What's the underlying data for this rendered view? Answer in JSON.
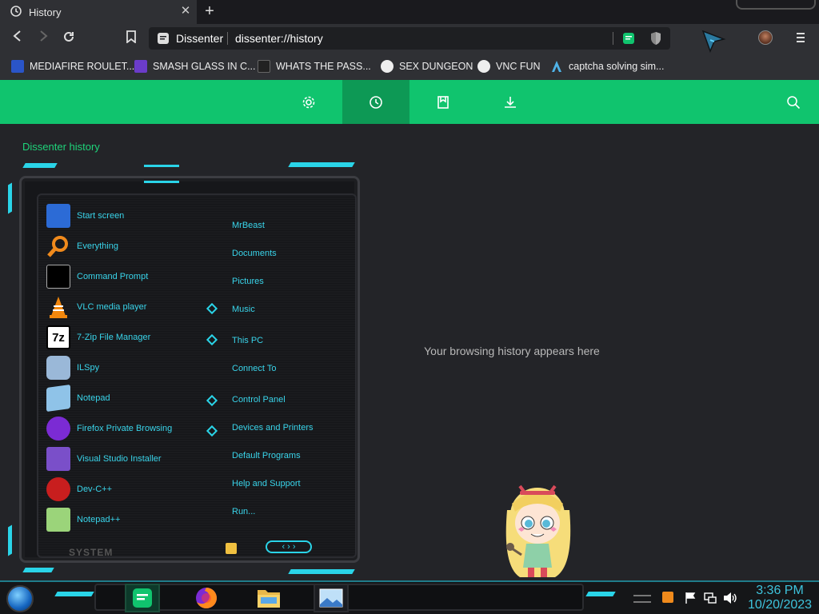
{
  "tab": {
    "title": "History",
    "close_icon": "close-icon",
    "new_tab_icon": "plus-icon"
  },
  "toolbar": {
    "site_name": "Dissenter",
    "url": "dissenter://history"
  },
  "bookmarks": [
    {
      "label": "MEDIAFIRE ROULET...",
      "icon": "mediafire-icon",
      "color": "#2a55c8"
    },
    {
      "label": "SMASH GLASS IN C...",
      "icon": "visualstudio-icon",
      "color": "#6b3cc9"
    },
    {
      "label": "WHATS THE PASS...",
      "icon": "site-icon",
      "color": "#222222"
    },
    {
      "label": "SEX DUNGEON",
      "icon": "github-icon",
      "color": "#eeeeee"
    },
    {
      "label": "VNC FUN",
      "icon": "github-icon",
      "color": "#eeeeee"
    },
    {
      "label": "captcha solving sim...",
      "icon": "arch-icon",
      "color": "#4fb3e8"
    }
  ],
  "appbar": {
    "accent": "#10c46e",
    "buttons": [
      "settings-icon",
      "history-icon",
      "bookmark-icon",
      "download-icon"
    ],
    "active": "history-icon",
    "search_icon": "search-icon"
  },
  "history": {
    "title": "Dissenter history",
    "empty_message": "Your browsing history appears here"
  },
  "start_menu": {
    "programs": [
      {
        "label": "Start screen",
        "icon": "start-screen-icon",
        "color": "#2c6bd6"
      },
      {
        "label": "Everything",
        "icon": "magnifier-icon",
        "color": "#f08a1c"
      },
      {
        "label": "Command Prompt",
        "icon": "cmd-icon",
        "color": "#111111"
      },
      {
        "label": "VLC media player",
        "icon": "vlc-icon",
        "color": "#f2870d"
      },
      {
        "label": "7-Zip File Manager",
        "icon": "7zip-icon",
        "color": "#ffffff"
      },
      {
        "label": "ILSpy",
        "icon": "ilspy-icon",
        "color": "#9ab8d8"
      },
      {
        "label": "Notepad",
        "icon": "notepad-icon",
        "color": "#8fc3e8"
      },
      {
        "label": "Firefox Private Browsing",
        "icon": "firefox-private-icon",
        "color": "#7b2bd4"
      },
      {
        "label": "Visual Studio Installer",
        "icon": "vs-installer-icon",
        "color": "#7a4fc9"
      },
      {
        "label": "Dev-C++",
        "icon": "devcpp-icon",
        "color": "#c81e1e"
      },
      {
        "label": "Notepad++",
        "icon": "notepadpp-icon",
        "color": "#9bd47a"
      }
    ],
    "places": [
      "MrBeast",
      "Documents",
      "Pictures",
      "Music",
      "This PC",
      "Connect To",
      "Control Panel",
      "Devices and Printers",
      "Default Programs",
      "Help and Support",
      "Run..."
    ],
    "system_label": "SYSTEM"
  },
  "taskbar": {
    "apps": [
      "notes-app-icon",
      "firefox-icon",
      "file-explorer-icon",
      "image-viewer-icon"
    ],
    "time": "3:36 PM",
    "date": "10/20/2023"
  }
}
